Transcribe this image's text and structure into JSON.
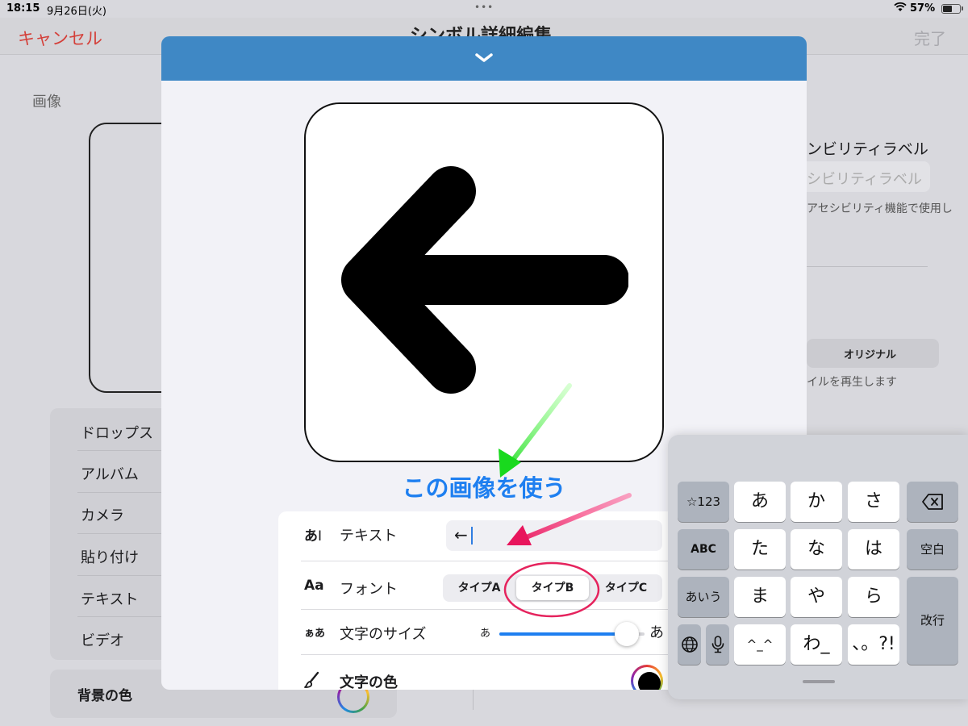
{
  "status_bar": {
    "time": "18:15",
    "date": "9月26日(火)",
    "battery_percent": "57%",
    "battery_level": 0.57
  },
  "nav": {
    "cancel": "キャンセル",
    "done": "完了",
    "title": "シンボル詳細編集"
  },
  "background": {
    "image_label": "画像",
    "source_list": [
      "ドロップス",
      "アルバム",
      "カメラ",
      "貼り付け",
      "テキスト",
      "ビデオ"
    ],
    "bg_color_label": "背景の色",
    "accessibility_label_title": "ンビリティラベル",
    "accessibility_placeholder": "シビリティラベル",
    "accessibility_note": "アセシビリティ機能で使用し",
    "segment_label": "オリジナル",
    "video_note": "イルを再生します"
  },
  "sheet": {
    "use_image_button": "この画像を使う",
    "text_row": {
      "icon": "あ",
      "label": "テキスト",
      "value": "←"
    },
    "font_row": {
      "icon": "Aa",
      "label": "フォント",
      "options": [
        "タイプA",
        "タイプB",
        "タイプC"
      ],
      "selected": "タイプB"
    },
    "size_row": {
      "icon": "ぁあ",
      "label": "文字のサイズ",
      "min_label": "あ",
      "max_label": "あ",
      "value": 0.88
    },
    "color_row": {
      "label": "文字の色",
      "color": "#000000"
    }
  },
  "keyboard": {
    "keys": {
      "k123": "☆123",
      "a": "あ",
      "ka": "か",
      "sa": "さ",
      "abc": "ABC",
      "ta": "た",
      "na": "な",
      "ha": "は",
      "space": "空白",
      "aiu": "あいう",
      "ma": "ま",
      "ya": "や",
      "ra": "ら",
      "enter": "改行",
      "kao": "^_^",
      "wa": "わ_",
      "punct": "、。?!"
    }
  },
  "colors": {
    "accent": "#1e7ff0",
    "header": "#3f88c5",
    "cancel": "#d4403a",
    "annotation_green": "#22dd22",
    "annotation_pink": "#ee2266"
  }
}
